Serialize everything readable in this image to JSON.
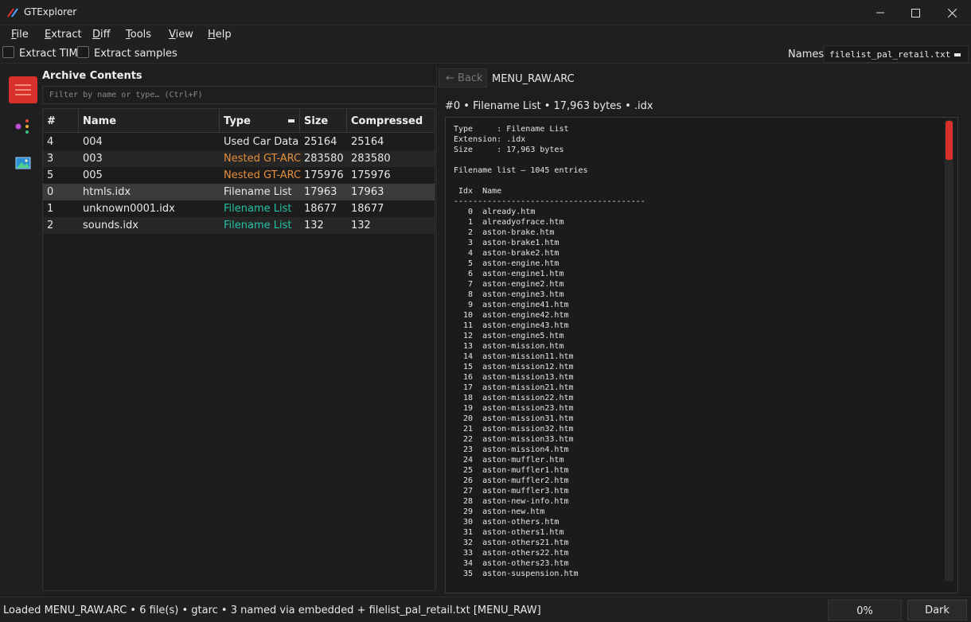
{
  "window": {
    "title": "GTExplorer"
  },
  "menu": [
    {
      "u": "F",
      "rest": "ile"
    },
    {
      "u": "E",
      "rest": "xtract"
    },
    {
      "u": "D",
      "rest": "iff"
    },
    {
      "u": "T",
      "rest": "ools"
    },
    {
      "u": "V",
      "rest": "iew"
    },
    {
      "u": "H",
      "rest": "elp"
    }
  ],
  "toolbar": {
    "extract_tims_label": "Extract TIMs",
    "extract_samples_label": "Extract samples",
    "names_label": "Names:",
    "names_value": "filelist_pal_retail.txt"
  },
  "left": {
    "title": "Archive Contents",
    "filter_placeholder": "Filter by name or type…  (Ctrl+F)",
    "columns": [
      "#",
      "Name",
      "Type",
      "Size",
      "Compressed"
    ],
    "rows": [
      {
        "idx": "4",
        "name": "004",
        "type": "Used Car Data",
        "size": "25164",
        "compressed": "25164",
        "type_style": "normal"
      },
      {
        "idx": "3",
        "name": "003",
        "type": "Nested GT-ARC",
        "size": "283580",
        "compressed": "283580",
        "type_style": "orange"
      },
      {
        "idx": "5",
        "name": "005",
        "type": "Nested GT-ARC",
        "size": "175976",
        "compressed": "175976",
        "type_style": "orange"
      },
      {
        "idx": "0",
        "name": "htmls.idx",
        "type": "Filename List",
        "size": "17963",
        "compressed": "17963",
        "type_style": "normal"
      },
      {
        "idx": "1",
        "name": "unknown0001.idx",
        "type": "Filename List",
        "size": "18677",
        "compressed": "18677",
        "type_style": "teal"
      },
      {
        "idx": "2",
        "name": "sounds.idx",
        "type": "Filename List",
        "size": "132",
        "compressed": "132",
        "type_style": "teal"
      }
    ]
  },
  "right": {
    "back_label": "← Back",
    "archive_name": "MENU_RAW.ARC",
    "info_line": "#0  •  Filename List  •  17,963 bytes  •  .idx",
    "viewer_text": "Type     : Filename List\nExtension: .idx\nSize     : 17,963 bytes\n\nFilename list — 1045 entries\n\n Idx  Name\n----------------------------------------\n   0  already.htm\n   1  alreadyofrace.htm\n   2  aston-brake.htm\n   3  aston-brake1.htm\n   4  aston-brake2.htm\n   5  aston-engine.htm\n   6  aston-engine1.htm\n   7  aston-engine2.htm\n   8  aston-engine3.htm\n   9  aston-engine41.htm\n  10  aston-engine42.htm\n  11  aston-engine43.htm\n  12  aston-engine5.htm\n  13  aston-mission.htm\n  14  aston-mission11.htm\n  15  aston-mission12.htm\n  16  aston-mission13.htm\n  17  aston-mission21.htm\n  18  aston-mission22.htm\n  19  aston-mission23.htm\n  20  aston-mission31.htm\n  21  aston-mission32.htm\n  22  aston-mission33.htm\n  23  aston-mission4.htm\n  24  aston-muffler.htm\n  25  aston-muffler1.htm\n  26  aston-muffler2.htm\n  27  aston-muffler3.htm\n  28  aston-new-info.htm\n  29  aston-new.htm\n  30  aston-others.htm\n  31  aston-others1.htm\n  32  aston-others21.htm\n  33  aston-others22.htm\n  34  aston-others23.htm\n  35  aston-suspension.htm"
  },
  "status": {
    "text": "Loaded MENU_RAW.ARC  •  6 file(s)  •  gtarc  •  3 named via embedded + filelist_pal_retail.txt [MENU_RAW]",
    "progress": "0%",
    "theme_button": "Dark"
  },
  "colors": {
    "accent": "#d9302b",
    "orange": "#e58e3b",
    "teal": "#24c2a6"
  }
}
